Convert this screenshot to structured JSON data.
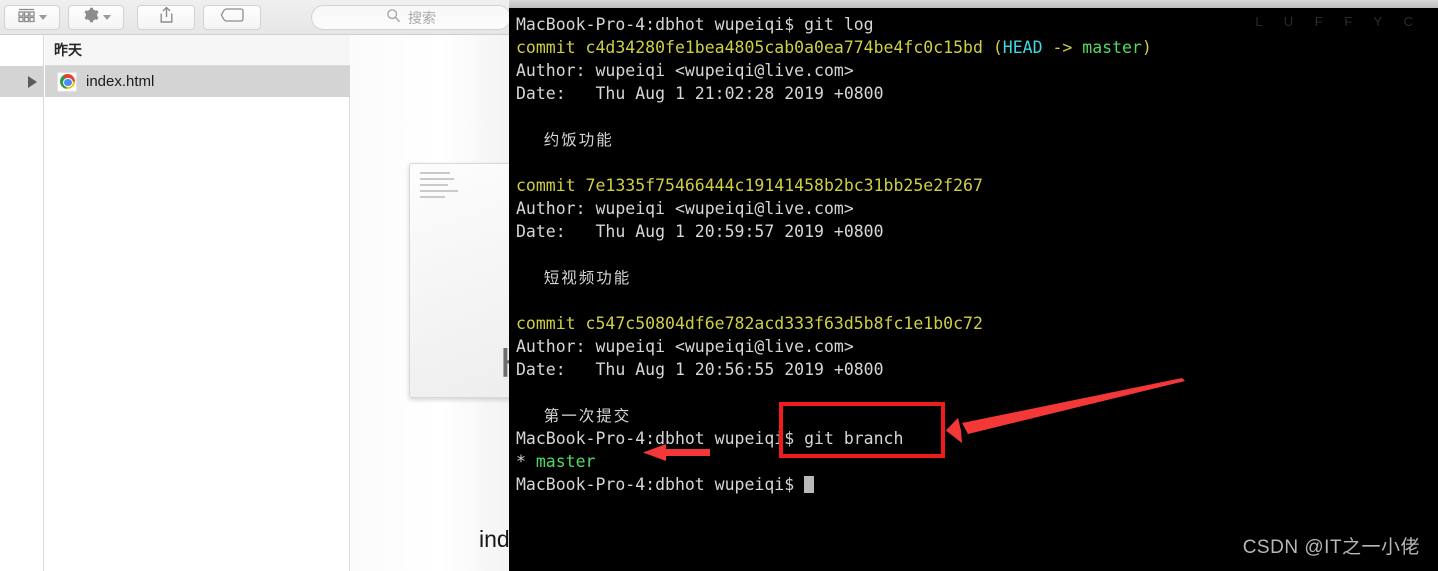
{
  "finder": {
    "toolbar": {
      "view_button": "icon-view",
      "action_button": "gear-actions",
      "share_button": "share",
      "tags_button": "tags",
      "search_placeholder": "搜索"
    },
    "group_header": "昨天",
    "files": [
      {
        "name": "index.html",
        "icon": "chrome-icon",
        "selected": true
      }
    ],
    "preview": {
      "file_type_label": "HT",
      "file_name": "index"
    }
  },
  "terminal": {
    "background_watermark": "L U F F Y C",
    "lines": [
      {
        "id": "l1",
        "segments": [
          {
            "text": "MacBook-Pro-4:dbhot wupeiqi$ git log",
            "color": "white"
          }
        ]
      },
      {
        "id": "l2",
        "segments": [
          {
            "text": "commit c4d34280fe1bea4805cab0a0ea774be4fc0c15bd ",
            "color": "yellow"
          },
          {
            "text": "(",
            "color": "yellow"
          },
          {
            "text": "HEAD",
            "color": "cyan"
          },
          {
            "text": " -> ",
            "color": "yellow"
          },
          {
            "text": "master",
            "color": "green"
          },
          {
            "text": ")",
            "color": "yellow"
          }
        ]
      },
      {
        "id": "l3",
        "segments": [
          {
            "text": "Author: wupeiqi <wupeiqi@live.com>",
            "color": "white"
          }
        ]
      },
      {
        "id": "l4",
        "segments": [
          {
            "text": "Date:   Thu Aug 1 21:02:28 2019 +0800",
            "color": "white"
          }
        ]
      },
      {
        "id": "l5",
        "segments": [
          {
            "text": "",
            "color": "white"
          }
        ]
      },
      {
        "id": "l6",
        "segments": [
          {
            "text": "    约饭功能",
            "color": "white",
            "cjk": true
          }
        ]
      },
      {
        "id": "l7",
        "segments": [
          {
            "text": "",
            "color": "white"
          }
        ]
      },
      {
        "id": "l8",
        "segments": [
          {
            "text": "commit 7e1335f75466444c19141458b2bc31bb25e2f267",
            "color": "yellow"
          }
        ]
      },
      {
        "id": "l9",
        "segments": [
          {
            "text": "Author: wupeiqi <wupeiqi@live.com>",
            "color": "white"
          }
        ]
      },
      {
        "id": "l10",
        "segments": [
          {
            "text": "Date:   Thu Aug 1 20:59:57 2019 +0800",
            "color": "white"
          }
        ]
      },
      {
        "id": "l11",
        "segments": [
          {
            "text": "",
            "color": "white"
          }
        ]
      },
      {
        "id": "l12",
        "segments": [
          {
            "text": "    短视频功能",
            "color": "white",
            "cjk": true
          }
        ]
      },
      {
        "id": "l13",
        "segments": [
          {
            "text": "",
            "color": "white"
          }
        ]
      },
      {
        "id": "l14",
        "segments": [
          {
            "text": "commit c547c50804df6e782acd333f63d5b8fc1e1b0c72",
            "color": "yellow"
          }
        ]
      },
      {
        "id": "l15",
        "segments": [
          {
            "text": "Author: wupeiqi <wupeiqi@live.com>",
            "color": "white"
          }
        ]
      },
      {
        "id": "l16",
        "segments": [
          {
            "text": "Date:   Thu Aug 1 20:56:55 2019 +0800",
            "color": "white"
          }
        ]
      },
      {
        "id": "l17",
        "segments": [
          {
            "text": "",
            "color": "white"
          }
        ]
      },
      {
        "id": "l18",
        "segments": [
          {
            "text": "    第一次提交",
            "color": "white",
            "cjk": true
          }
        ]
      },
      {
        "id": "l19",
        "segments": [
          {
            "text": "MacBook-Pro-4:dbhot wupeiqi$ git branch",
            "color": "white"
          }
        ]
      },
      {
        "id": "l20",
        "segments": [
          {
            "text": "* ",
            "color": "white"
          },
          {
            "text": "master",
            "color": "green"
          }
        ]
      },
      {
        "id": "l21",
        "segments": [
          {
            "text": "MacBook-Pro-4:dbhot wupeiqi$ ",
            "color": "white"
          },
          {
            "text": "",
            "color": "white",
            "cursor": true
          }
        ]
      }
    ]
  },
  "annotations": {
    "highlight_color": "#f01b1b",
    "box_target": "git branch command",
    "arrow_1_target": "git branch command",
    "arrow_2_target": "master branch entry"
  },
  "watermark": "CSDN @IT之一小佬"
}
